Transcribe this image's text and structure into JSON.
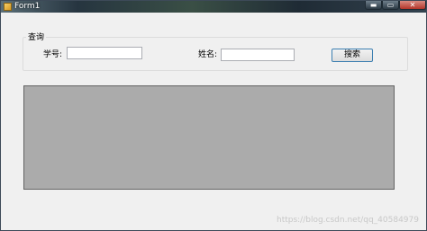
{
  "window": {
    "title": "Form1",
    "controls": {
      "minimize": "▬",
      "maximize": "▭",
      "close": "✕"
    },
    "icon": "app-form-icon"
  },
  "query_group": {
    "label": "查询",
    "student_id_label": "学号:",
    "student_id_value": "",
    "name_label": "姓名:",
    "name_value": "",
    "search_button": "搜索"
  },
  "watermark": "https://blog.csdn.net/qq_40584979",
  "colors": {
    "window_bg": "#f0f0f0",
    "grid_bg": "#ababab",
    "button_border": "#3c7fb1"
  }
}
